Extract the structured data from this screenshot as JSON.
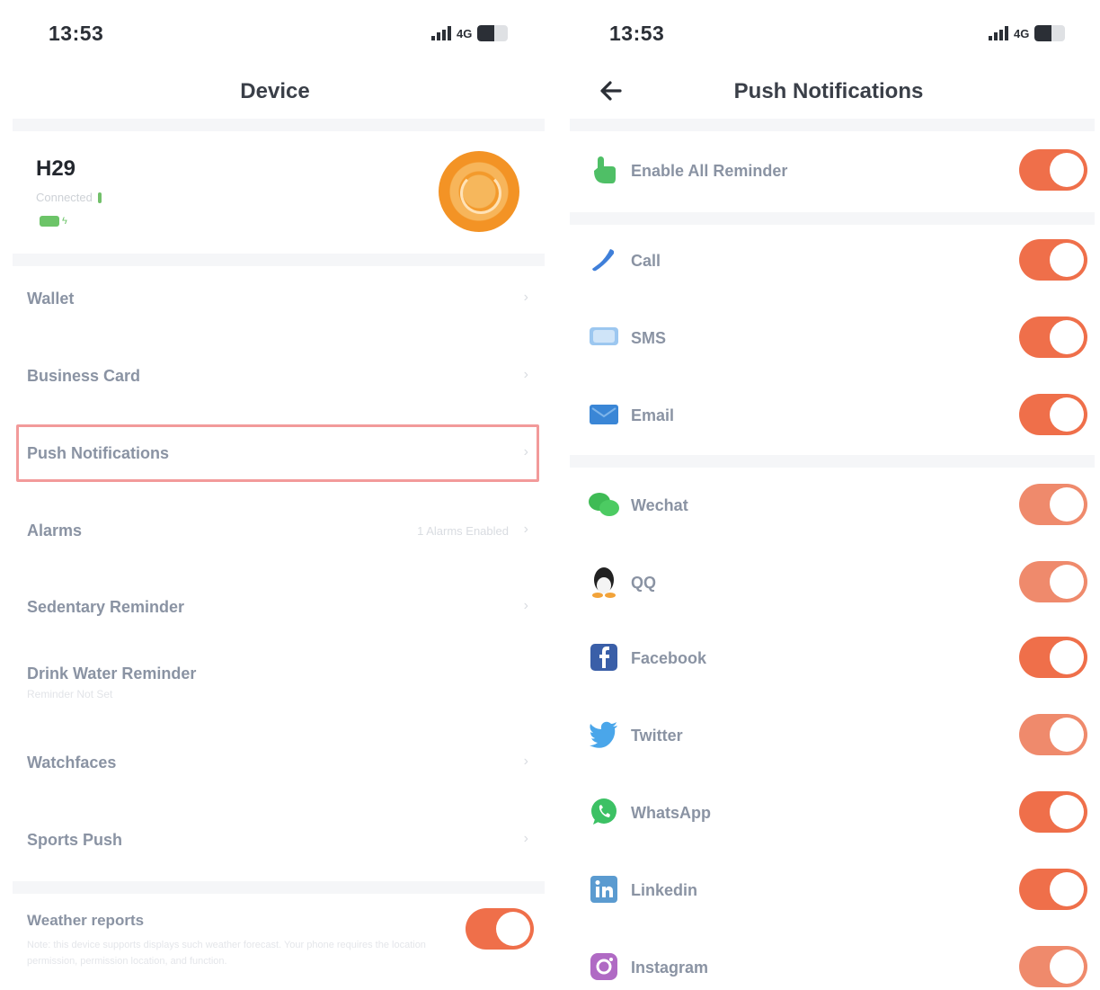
{
  "left": {
    "status": {
      "time": "13:53",
      "network": "4G"
    },
    "nav": {
      "title": "Device"
    },
    "device": {
      "name": "H29",
      "connection_status": "Connected"
    },
    "menu": [
      {
        "label": "Wallet"
      },
      {
        "label": "Business Card"
      },
      {
        "label": "Push Notifications"
      },
      {
        "label": "Alarms",
        "value": "1 Alarms Enabled"
      },
      {
        "label": "Sedentary Reminder"
      },
      {
        "label": "Drink Water Reminder",
        "sub": "Reminder Not Set"
      },
      {
        "label": "Watchfaces"
      },
      {
        "label": "Sports Push"
      }
    ],
    "weather": {
      "label": "Weather reports",
      "description": "Note: this device supports displays such weather forecast. Your phone requires the location permission, permission location, and function.",
      "enabled": true
    }
  },
  "right": {
    "status": {
      "time": "13:53",
      "network": "4G"
    },
    "nav": {
      "title": "Push Notifications"
    },
    "enable_all": {
      "label": "Enable All Reminder",
      "enabled": true
    },
    "items": [
      {
        "label": "Call",
        "icon": "phone-icon",
        "enabled": true
      },
      {
        "label": "SMS",
        "icon": "sms-icon",
        "enabled": true
      },
      {
        "label": "Email",
        "icon": "email-icon",
        "enabled": true
      },
      {
        "label": "Wechat",
        "icon": "wechat-icon",
        "enabled": true
      },
      {
        "label": "QQ",
        "icon": "qq-icon",
        "enabled": true
      },
      {
        "label": "Facebook",
        "icon": "facebook-icon",
        "enabled": true
      },
      {
        "label": "Twitter",
        "icon": "twitter-icon",
        "enabled": true
      },
      {
        "label": "WhatsApp",
        "icon": "whatsapp-icon",
        "enabled": true
      },
      {
        "label": "Linkedin",
        "icon": "linkedin-icon",
        "enabled": true
      },
      {
        "label": "Instagram",
        "icon": "instagram-icon",
        "enabled": true
      }
    ]
  },
  "colors": {
    "toggle_on": "#ef6f4a",
    "highlight": "#f29a9a",
    "label_text": "#8a93a3",
    "title_text": "#3a3f48"
  }
}
